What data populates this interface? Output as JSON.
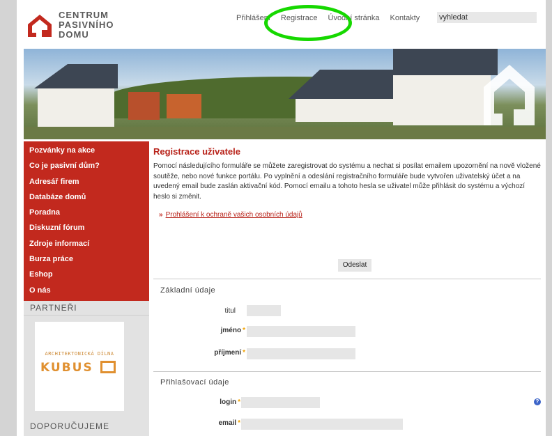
{
  "header": {
    "logo_lines": [
      "CENTRUM",
      "PASIVNÍHO",
      "DOMU"
    ],
    "nav": [
      "Přihlášení",
      "Registrace",
      "Úvodní stránka",
      "Kontakty"
    ],
    "search_value": "vyhledat",
    "highlight_color": "#16d800"
  },
  "sidebar": {
    "menu": [
      "Pozvánky na akce",
      "Co je pasivní dům?",
      "Adresář firem",
      "Databáze domů",
      "Poradna",
      "Diskuzní fórum",
      "Zdroje informací",
      "Burza práce",
      "Eshop",
      "O nás"
    ],
    "partneri_title": "PARTNEŘI",
    "partner_line1": "ARCHITEKTONICKÁ DÍLNA",
    "partner_word": "KUBUS",
    "doporucujeme_title": "DOPORUČUJEME"
  },
  "main": {
    "title": "Registrace uživatele",
    "intro": "Pomocí následujícího formuláře se můžete zaregistrovat do systému a nechat si posílat emailem upozornění na nově vložené soutěže, nebo nové funkce portálu. Po vyplnění a odeslání registračního formuláře bude vytvořen uživatelský účet a na uvedený email bude zaslán aktivační kód. Pomocí emailu a tohoto hesla se uživatel může přihlásit do systému a výchozí heslo si změnit.",
    "privacy_arrow": "»",
    "privacy_link": "Prohlášení k ochraně vašich osobních údajů",
    "submit_label": "Odeslat",
    "section_basic": "Základní údaje",
    "label_titul": "titul",
    "label_jmeno": "jméno",
    "label_prijmeni": "příjmení",
    "section_login": "Přihlašovací údaje",
    "label_login": "login",
    "label_email": "email",
    "required_mark": "*",
    "help_icon": "?"
  },
  "colors": {
    "brand_red": "#c2291e",
    "required": "#f0a000"
  }
}
